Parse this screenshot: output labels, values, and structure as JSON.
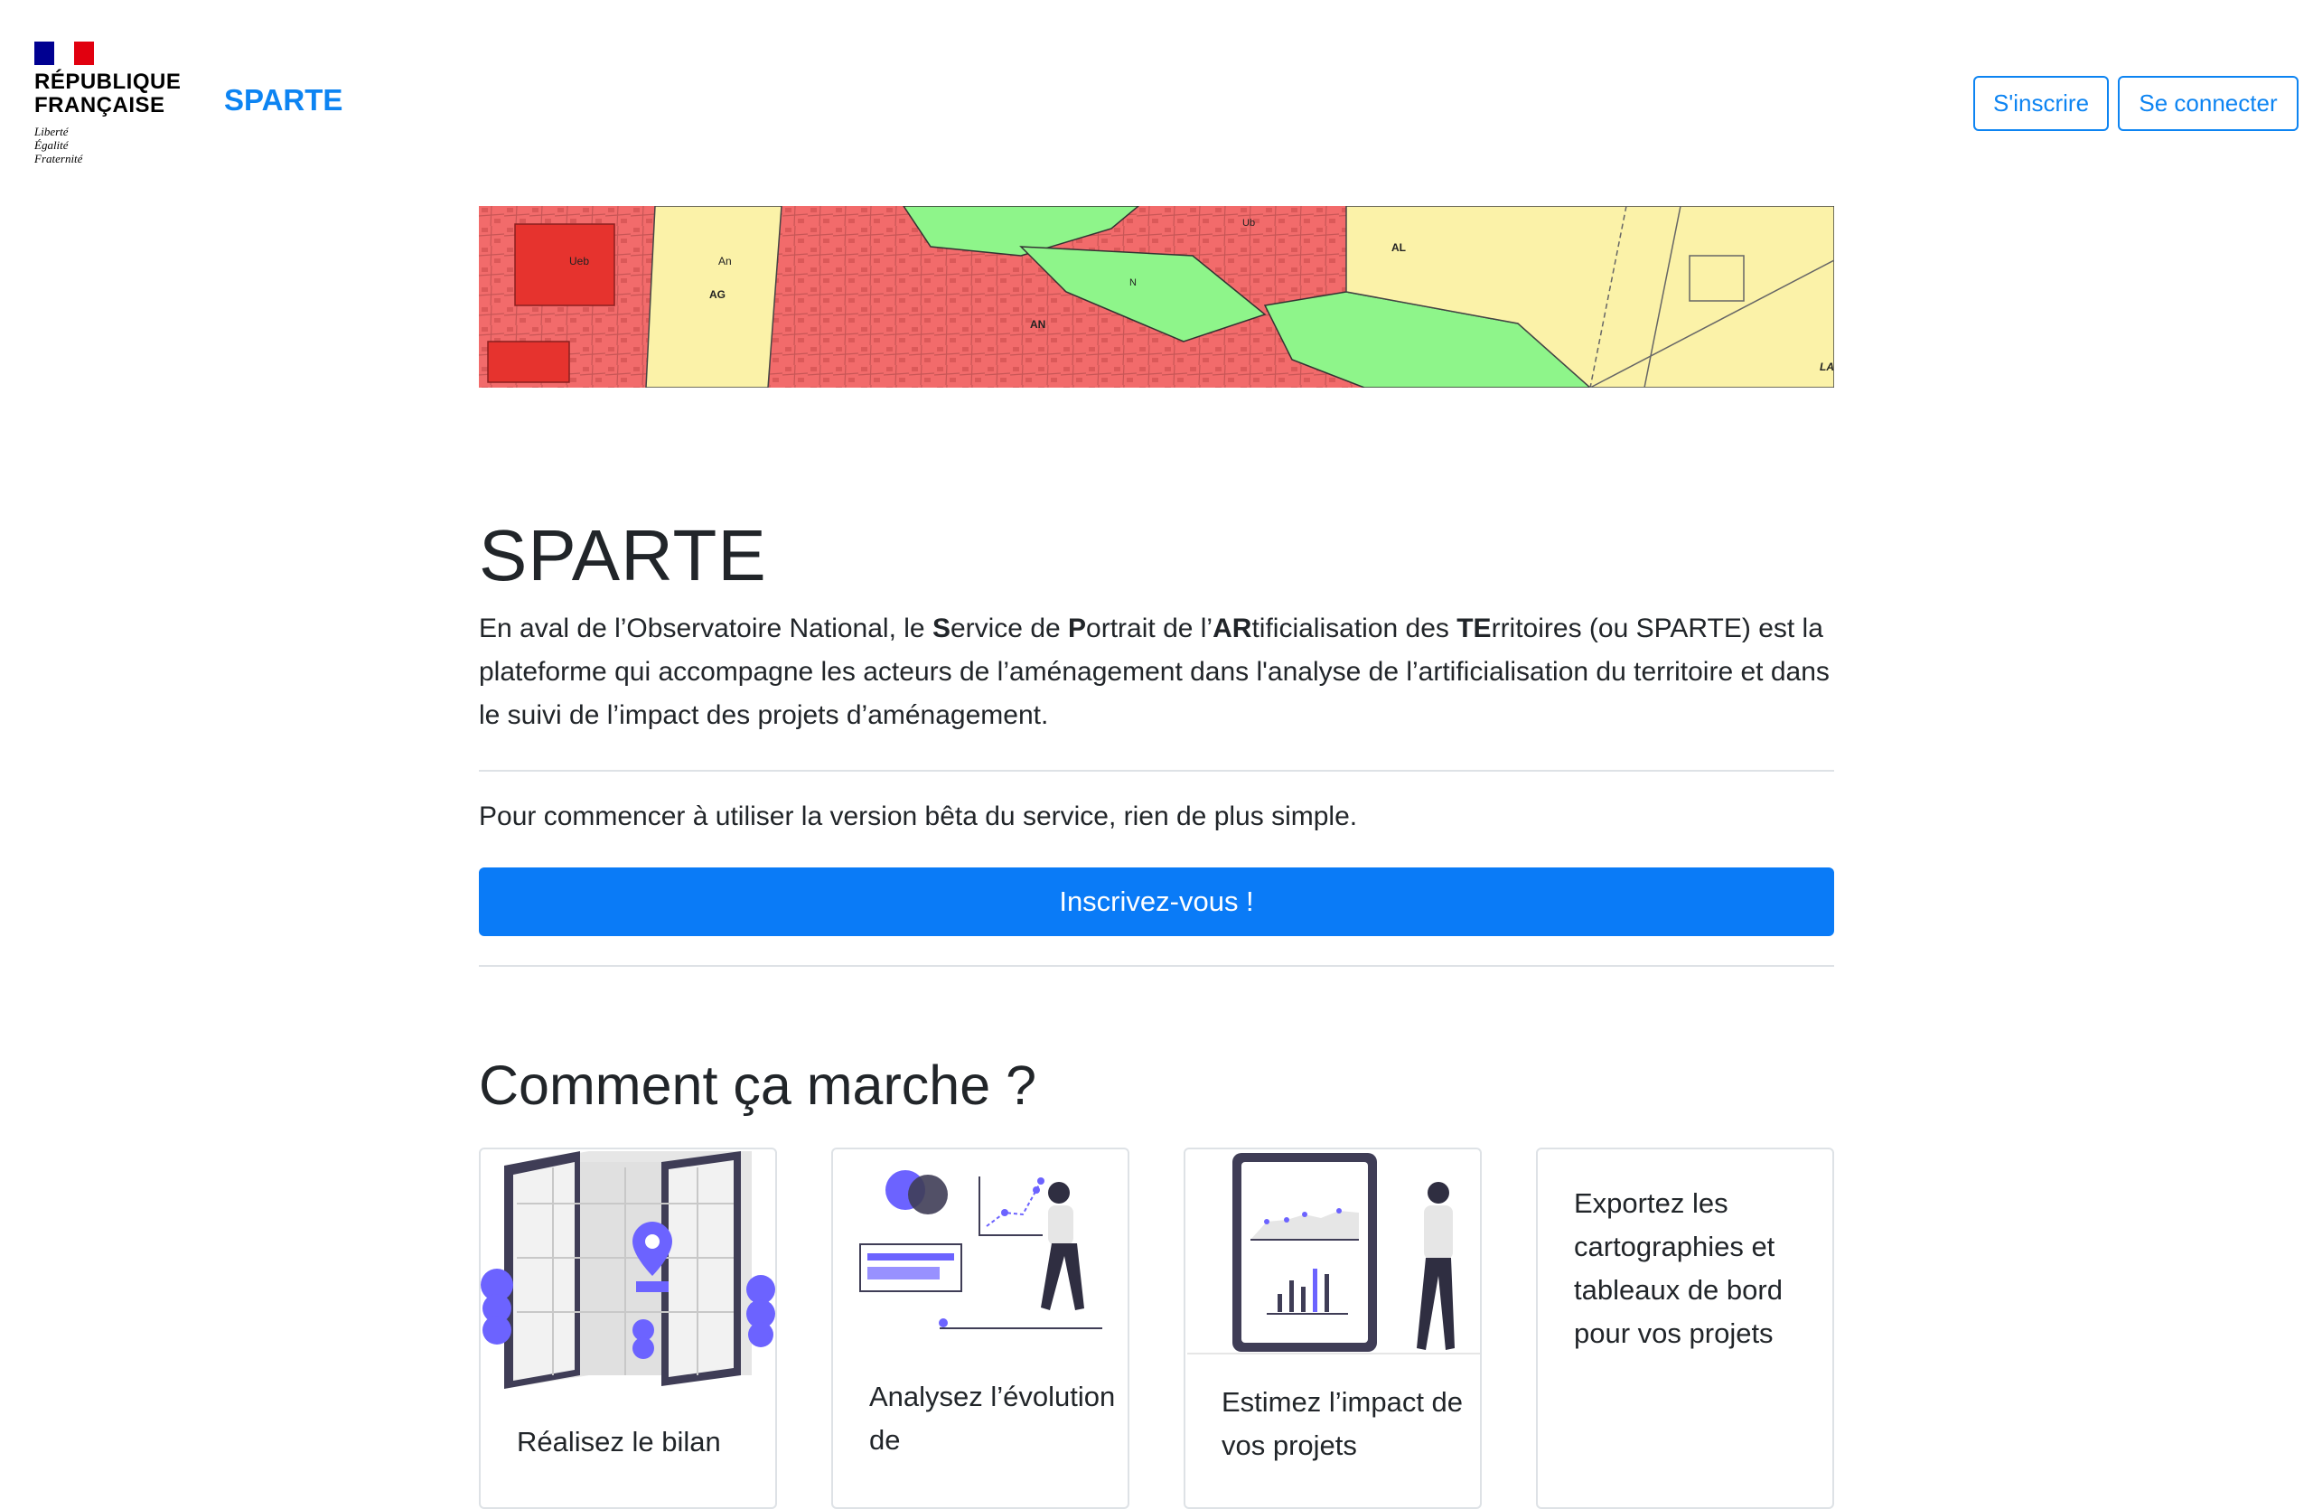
{
  "header": {
    "gov_name_line1": "RÉPUBLIQUE",
    "gov_name_line2": "FRANÇAISE",
    "motto_1": "Liberté",
    "motto_2": "Égalité",
    "motto_3": "Fraternité",
    "brand": "SPARTE",
    "signup_label": "S'inscrire",
    "login_label": "Se connecter"
  },
  "banner": {
    "labels": [
      "Ueb",
      "An",
      "AG",
      "AN",
      "N",
      "AL",
      "LA",
      "Ub"
    ],
    "colors": {
      "urban": "#f26b6b",
      "agri": "#fbf2a8",
      "natural": "#8ef58a"
    }
  },
  "main": {
    "title": "SPARTE",
    "intro": {
      "t1": "En aval de l’Observatoire National, le ",
      "b1": "S",
      "t2": "ervice de ",
      "b2": "P",
      "t3": "ortrait de l’",
      "b3": "AR",
      "t4": "tificialisation des ",
      "b4": "TE",
      "t5": "rritoires (ou SPARTE) est la plateforme qui accompagne les acteurs de l’aménagement dans l'analyse de l’artificialisation du territoire et dans le suivi de l’impact des projets d’aménagement."
    },
    "start_text": "Pour commencer à utiliser la version bêta du service, rien de plus simple.",
    "cta_label": "Inscrivez-vous !",
    "section_title": "Comment ça marche ?"
  },
  "cards": [
    {
      "text": "Réalisez le bilan",
      "icon": "map-illustration"
    },
    {
      "text": "Analysez l’évolution de",
      "icon": "analytics-illustration"
    },
    {
      "text": "Estimez l’impact de vos projets",
      "icon": "dashboard-illustration"
    },
    {
      "text": "Exportez les cartographies et tableaux de bord pour vos projets"
    }
  ],
  "colors": {
    "accent": "#0d84f2",
    "button": "#0a7bf7",
    "illustration": "#6c63ff",
    "dark": "#3f3d56"
  }
}
